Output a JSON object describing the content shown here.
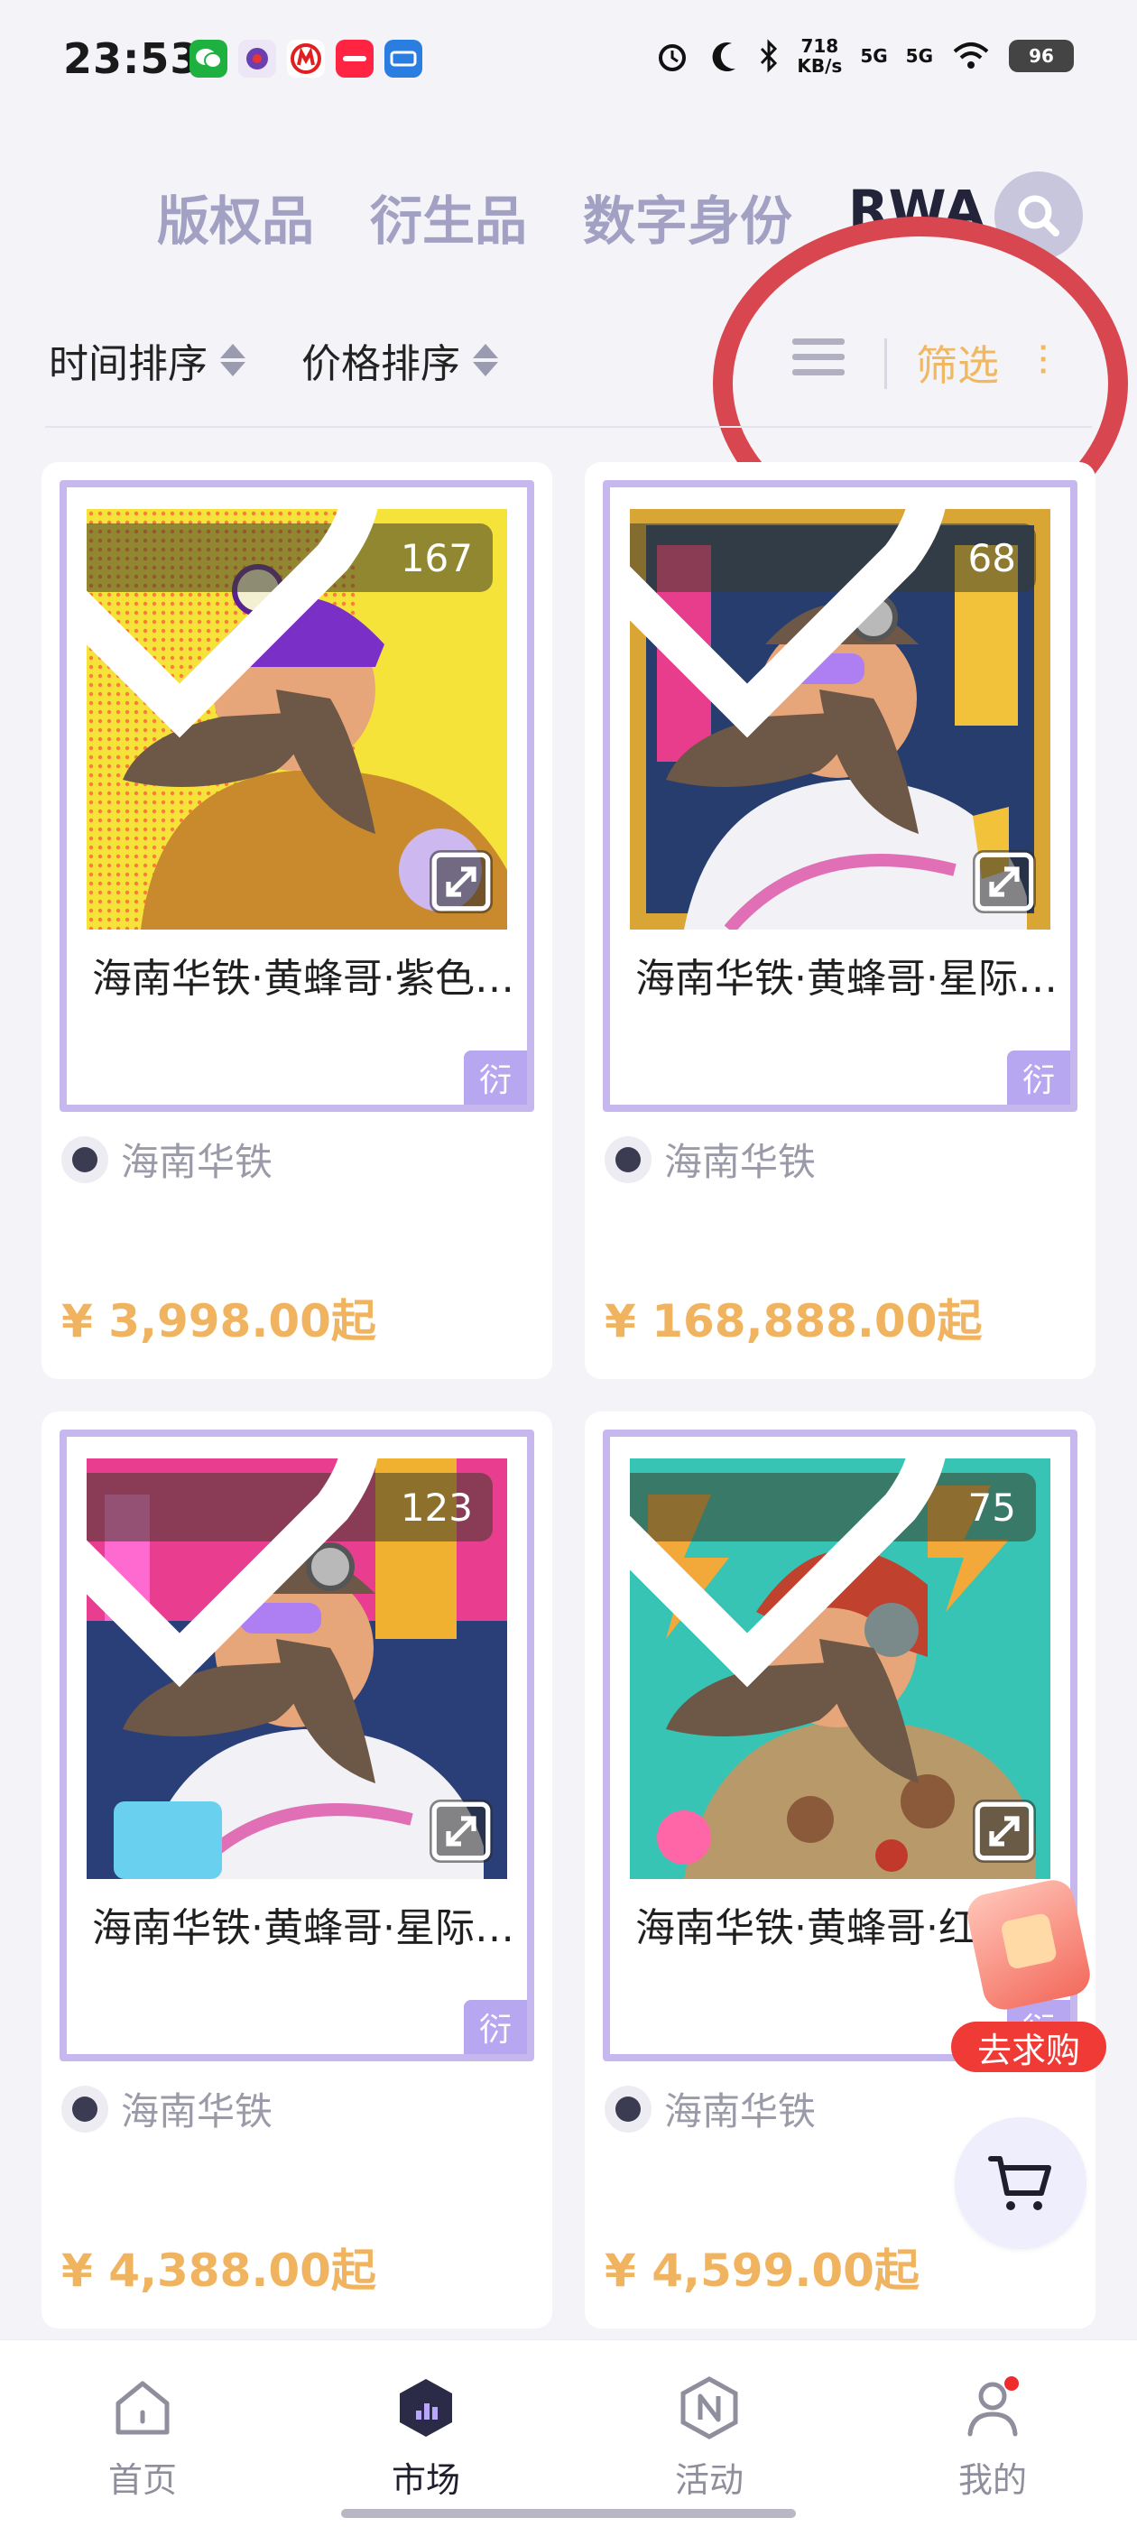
{
  "status_bar": {
    "time": "23:53",
    "apps": [
      "wechat-icon",
      "app-icon",
      "metro-icon",
      "xiaohongshu-icon",
      "traffic-12123-icon"
    ],
    "net_speed": "718",
    "net_speed_unit": "KB/s",
    "net_type_1": "5G",
    "net_type_2": "5G",
    "battery": "96"
  },
  "tabs": [
    {
      "label": "版权品",
      "active": false
    },
    {
      "label": "衍生品",
      "active": false
    },
    {
      "label": "数字身份",
      "active": false
    },
    {
      "label": "RWA",
      "active": true
    }
  ],
  "sort": {
    "time_label": "时间排序",
    "price_label": "价格排序",
    "filter_label": "筛选"
  },
  "products": [
    {
      "title": "海南华铁·黄蜂哥·紫色安全帽",
      "likes": "167",
      "badge": "衍",
      "issuer": "海南华铁",
      "price": "¥ 3,998.00起"
    },
    {
      "title": "海南华铁·黄蜂哥·星际金框",
      "likes": "68",
      "badge": "衍",
      "issuer": "海南华铁",
      "price": "¥ 168,888.00起"
    },
    {
      "title": "海南华铁·黄蜂哥·星际宇航员",
      "likes": "123",
      "badge": "衍",
      "issuer": "海南华铁",
      "price": "¥ 4,388.00起"
    },
    {
      "title": "海南华铁·黄蜂哥·红色安全帽",
      "likes": "75",
      "badge": "衍",
      "issuer": "海南华铁",
      "price": "¥ 4,599.00起"
    }
  ],
  "floating": {
    "promo_label": "去求购",
    "cart_icon": "cart-icon"
  },
  "bottom_nav": [
    {
      "label": "首页",
      "icon": "home-icon",
      "active": false
    },
    {
      "label": "市场",
      "icon": "market-icon",
      "active": true
    },
    {
      "label": "活动",
      "icon": "activity-icon",
      "active": false
    },
    {
      "label": "我的",
      "icon": "profile-icon",
      "active": false
    }
  ],
  "colors": {
    "accent": "#f0b460",
    "frame": "#c6b8ef",
    "badge": "#b7a6f0",
    "annotation_circle": "#d8464f"
  }
}
